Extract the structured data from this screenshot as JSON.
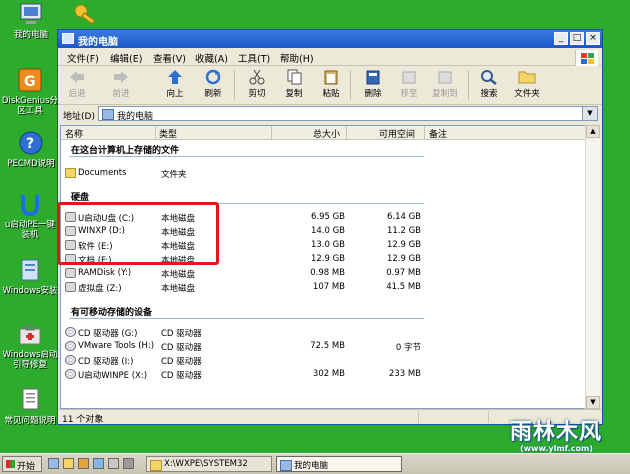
{
  "desktop_icons": [
    {
      "label": "我的电脑"
    },
    {
      "label": "DiskGenius分区工具"
    },
    {
      "label": "PECMD说明"
    },
    {
      "label": "u启动PE一键装机"
    },
    {
      "label": "Windows安装"
    },
    {
      "label": "Windows启动引导修复"
    },
    {
      "label": "常见问题说明"
    }
  ],
  "window": {
    "title": "我的电脑",
    "menu": [
      "文件(F)",
      "编辑(E)",
      "查看(V)",
      "收藏(A)",
      "工具(T)",
      "帮助(H)"
    ],
    "toolbar": [
      "后退",
      "前进",
      "向上",
      "刷新",
      "剪切",
      "复制",
      "粘贴",
      "删除",
      "移至",
      "复制到",
      "搜索",
      "文件夹"
    ],
    "address_label": "地址(D)",
    "address_value": "我的电脑",
    "columns": [
      "名称",
      "类型",
      "总大小",
      "可用空间",
      "备注"
    ],
    "groups": {
      "stored": "在这台计算机上存储的文件",
      "hdd": "硬盘",
      "removable": "有可移动存储的设备"
    },
    "stored_items": [
      {
        "name": "Documents",
        "type": "文件夹",
        "total": "",
        "free": ""
      }
    ],
    "hdd_items": [
      {
        "name": "U启动U盘 (C:)",
        "type": "本地磁盘",
        "total": "6.95 GB",
        "free": "6.14 GB"
      },
      {
        "name": "WINXP (D:)",
        "type": "本地磁盘",
        "total": "14.0 GB",
        "free": "11.2 GB"
      },
      {
        "name": "软件 (E:)",
        "type": "本地磁盘",
        "total": "13.0 GB",
        "free": "12.9 GB"
      },
      {
        "name": "文档 (F:)",
        "type": "本地磁盘",
        "total": "12.9 GB",
        "free": "12.9 GB"
      },
      {
        "name": "RAMDisk (Y:)",
        "type": "本地磁盘",
        "total": "0.98 MB",
        "free": "0.97 MB"
      },
      {
        "name": "虚拟盘 (Z:)",
        "type": "本地磁盘",
        "total": "107 MB",
        "free": "41.5 MB"
      }
    ],
    "removable_items": [
      {
        "name": "CD 驱动器 (G:)",
        "type": "CD 驱动器",
        "total": "",
        "free": ""
      },
      {
        "name": "VMware Tools (H:)",
        "type": "CD 驱动器",
        "total": "72.5 MB",
        "free": "0 字节"
      },
      {
        "name": "CD 驱动器 (I:)",
        "type": "CD 驱动器",
        "total": "",
        "free": ""
      },
      {
        "name": "U启动WINPE (X:)",
        "type": "CD 驱动器",
        "total": "302 MB",
        "free": "233 MB"
      }
    ],
    "status": "11 个对象"
  },
  "taskbar": {
    "start": "开始",
    "tasks": [
      "X:\\WXPE\\SYSTEM32",
      "我的电脑"
    ]
  },
  "watermark": {
    "big": "雨林木风",
    "small": "(www.ylmf.com)"
  },
  "colors": {
    "highlight": "#e11818",
    "desktop": "#2cab2c",
    "titlebar": "#1c56c8"
  }
}
